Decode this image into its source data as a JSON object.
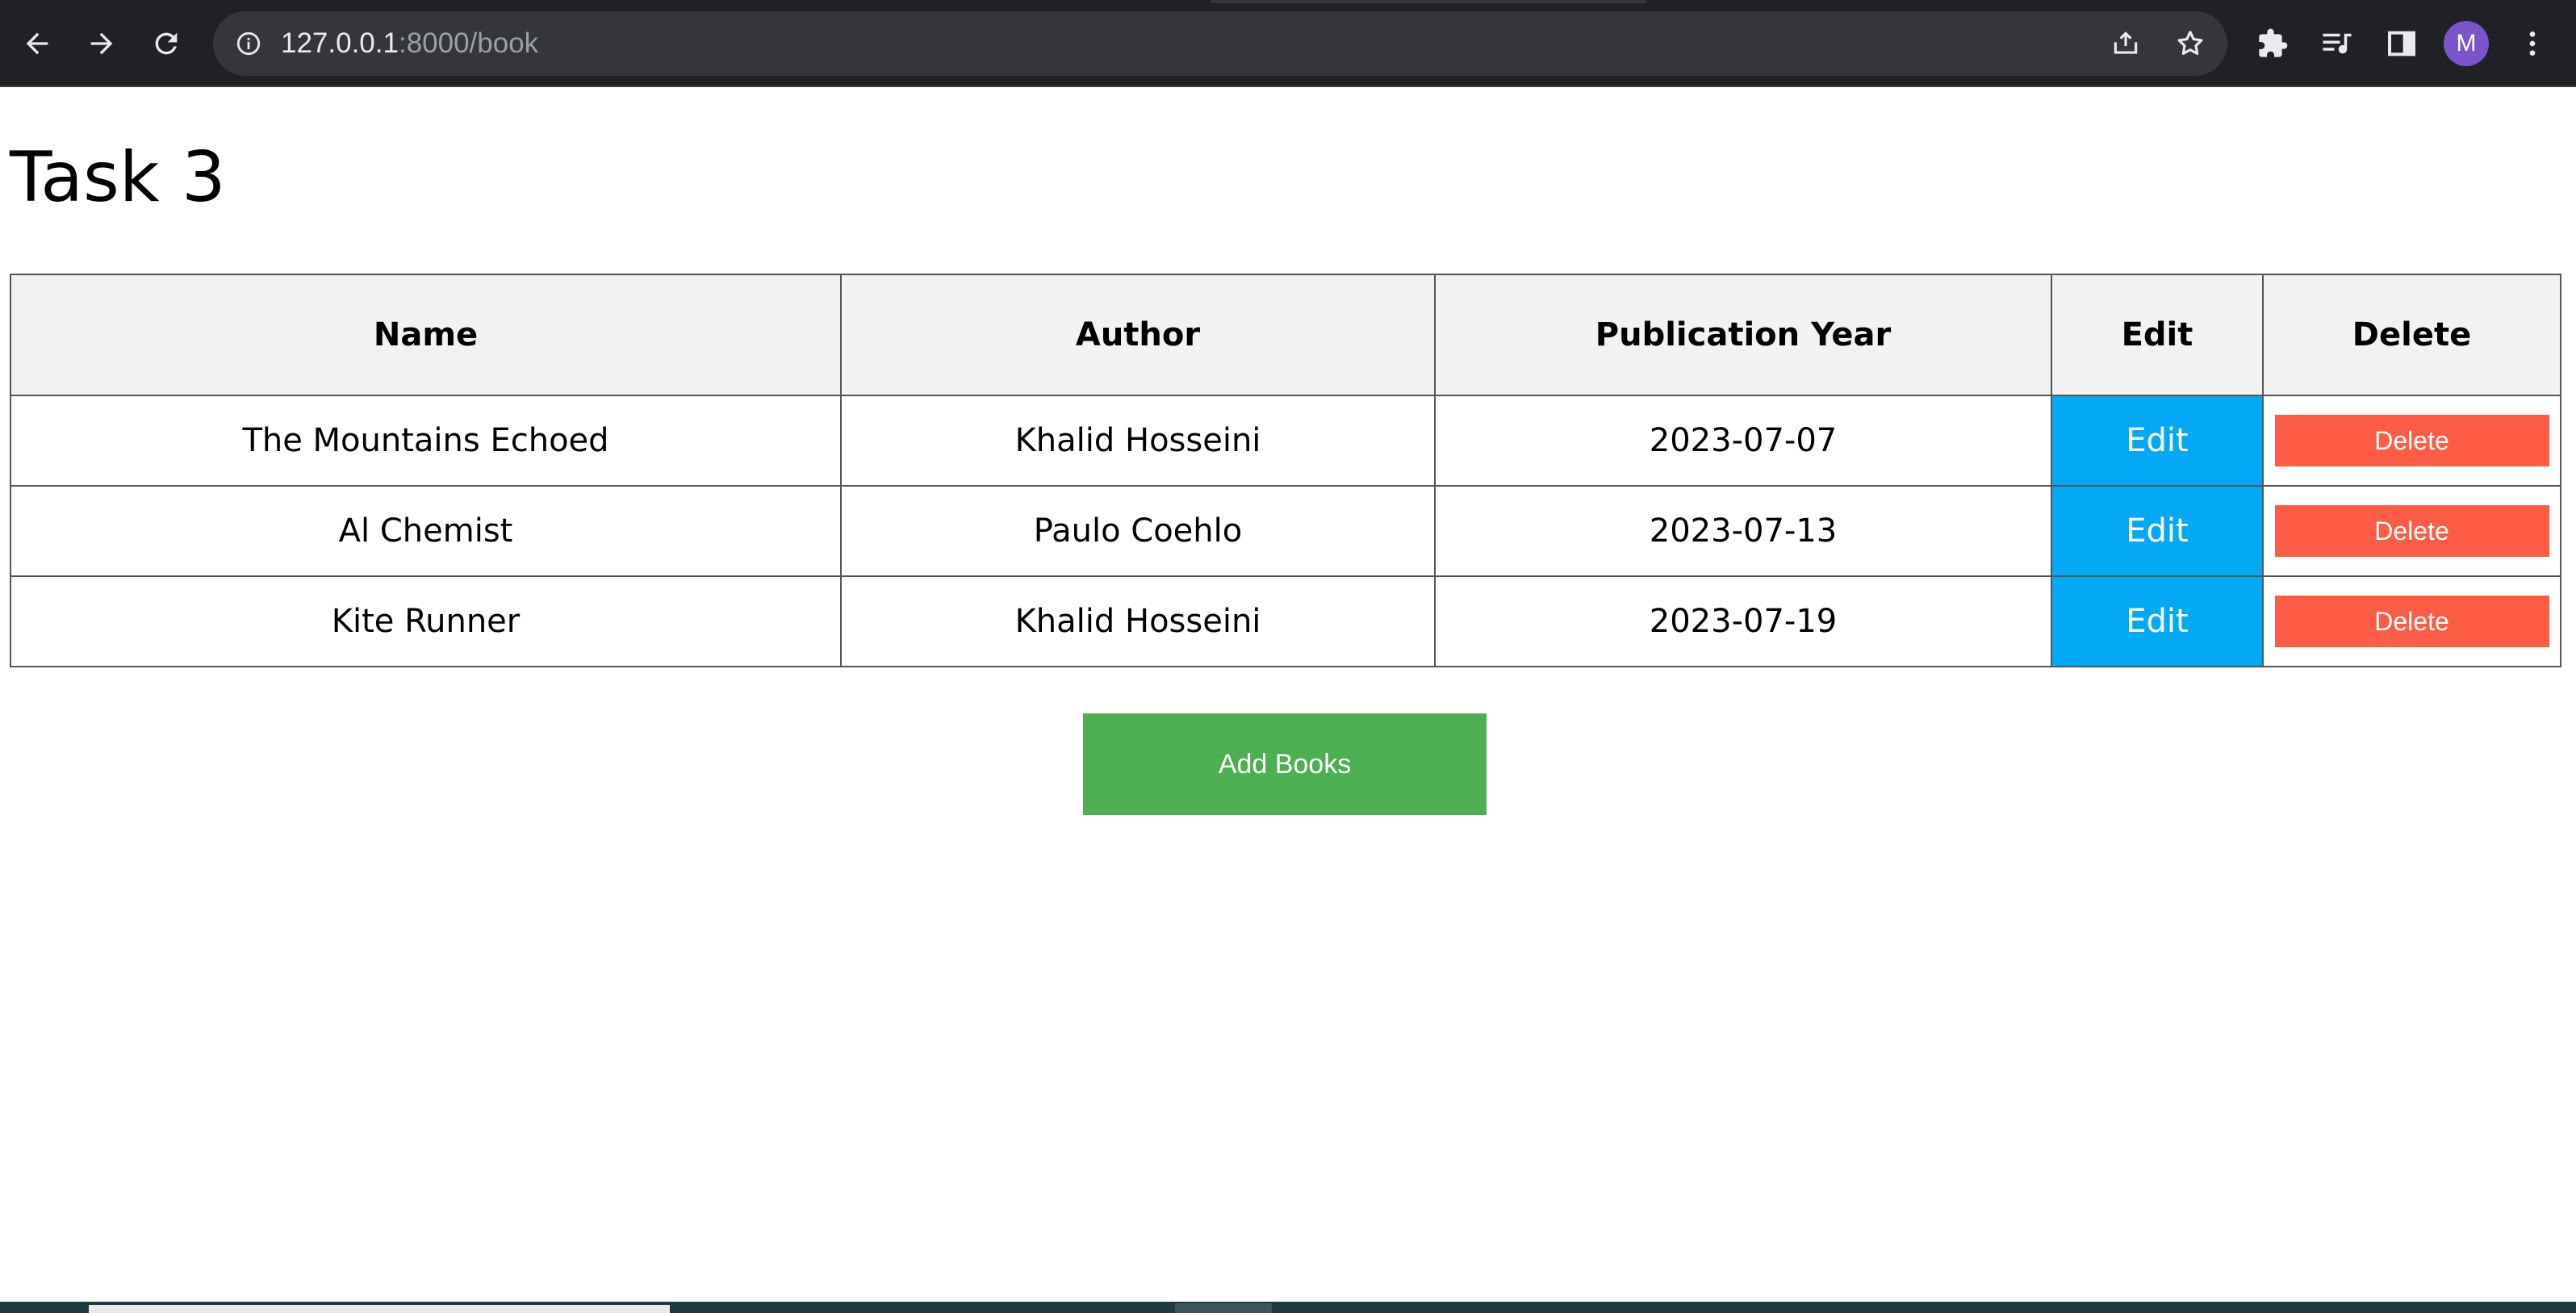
{
  "browser": {
    "url_host": "127.0.0.1",
    "url_path": ":8000/book",
    "avatar_letter": "M"
  },
  "icons": {
    "back": "back-arrow-icon",
    "forward": "forward-arrow-icon",
    "reload": "reload-icon",
    "site_info": "info-icon",
    "share": "share-icon",
    "bookmark": "star-icon",
    "extensions": "puzzle-icon",
    "media": "media-playlist-icon",
    "side_panel": "side-panel-icon",
    "menu": "kebab-menu-icon"
  },
  "page": {
    "title": "Task 3"
  },
  "table": {
    "headers": [
      "Name",
      "Author",
      "Publication Year",
      "Edit",
      "Delete"
    ],
    "rows": [
      {
        "name": "The Mountains Echoed",
        "author": "Khalid Hosseini",
        "year": "2023-07-07",
        "edit": "Edit",
        "delete": "Delete"
      },
      {
        "name": "Al Chemist",
        "author": "Paulo Coehlo",
        "year": "2023-07-13",
        "edit": "Edit",
        "delete": "Delete"
      },
      {
        "name": "Kite Runner",
        "author": "Khalid Hosseini",
        "year": "2023-07-19",
        "edit": "Edit",
        "delete": "Delete"
      }
    ]
  },
  "actions": {
    "add_label": "Add Books"
  },
  "colors": {
    "edit": "#03a9f4",
    "delete": "#ff5c45",
    "add": "#4caf50",
    "header_bg": "#f2f2f2",
    "avatar": "#7b54c9"
  }
}
